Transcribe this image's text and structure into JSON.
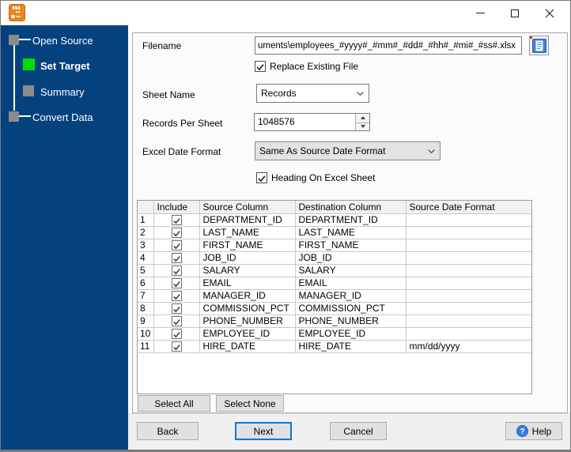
{
  "titlebar": {
    "window_buttons": [
      "minimize",
      "maximize",
      "close"
    ]
  },
  "icons": {
    "help_glyph": "?"
  },
  "sidebar": {
    "steps": [
      {
        "label": "Open Source",
        "status": "visited",
        "indent": 0
      },
      {
        "label": "Set Target",
        "status": "current",
        "indent": 1
      },
      {
        "label": "Summary",
        "status": "upcoming",
        "indent": 1
      },
      {
        "label": "Convert Data",
        "status": "upcoming",
        "indent": 0
      }
    ],
    "colors": {
      "background": "#04417f",
      "current_step": "#00dd00",
      "other_step": "#8c8c8c"
    }
  },
  "form": {
    "filename": {
      "label": "Filename",
      "value": "uments\\employees_#yyyy#_#mm#_#dd#_#hh#_#mi#_#ss#.xlsx"
    },
    "replace_existing": {
      "label": "Replace Existing File",
      "checked": true
    },
    "sheet_name": {
      "label": "Sheet Name",
      "value": "Records"
    },
    "records_per_sheet": {
      "label": "Records Per Sheet",
      "value": "1048576"
    },
    "excel_date_format": {
      "label": "Excel Date Format",
      "value": "Same As Source Date Format"
    },
    "heading": {
      "label": "Heading On Excel Sheet",
      "checked": true
    }
  },
  "table": {
    "headers": {
      "row": "",
      "include": "Include",
      "source": "Source Column",
      "destination": "Destination Column",
      "date_format": "Source Date Format"
    },
    "rows": [
      {
        "num": "1",
        "include": true,
        "source": "DEPARTMENT_ID",
        "destination": "DEPARTMENT_ID",
        "date_format": ""
      },
      {
        "num": "2",
        "include": true,
        "source": "LAST_NAME",
        "destination": "LAST_NAME",
        "date_format": ""
      },
      {
        "num": "3",
        "include": true,
        "source": "FIRST_NAME",
        "destination": "FIRST_NAME",
        "date_format": ""
      },
      {
        "num": "4",
        "include": true,
        "source": "JOB_ID",
        "destination": "JOB_ID",
        "date_format": ""
      },
      {
        "num": "5",
        "include": true,
        "source": "SALARY",
        "destination": "SALARY",
        "date_format": ""
      },
      {
        "num": "6",
        "include": true,
        "source": "EMAIL",
        "destination": "EMAIL",
        "date_format": ""
      },
      {
        "num": "7",
        "include": true,
        "source": "MANAGER_ID",
        "destination": "MANAGER_ID",
        "date_format": ""
      },
      {
        "num": "8",
        "include": true,
        "source": "COMMISSION_PCT",
        "destination": "COMMISSION_PCT",
        "date_format": ""
      },
      {
        "num": "9",
        "include": true,
        "source": "PHONE_NUMBER",
        "destination": "PHONE_NUMBER",
        "date_format": ""
      },
      {
        "num": "10",
        "include": true,
        "source": "EMPLOYEE_ID",
        "destination": "EMPLOYEE_ID",
        "date_format": ""
      },
      {
        "num": "11",
        "include": true,
        "source": "HIRE_DATE",
        "destination": "HIRE_DATE",
        "date_format": "mm/dd/yyyy"
      }
    ]
  },
  "buttons": {
    "select_all": "Select All",
    "select_none": "Select None",
    "back": "Back",
    "next": "Next",
    "cancel": "Cancel",
    "help": "Help"
  }
}
